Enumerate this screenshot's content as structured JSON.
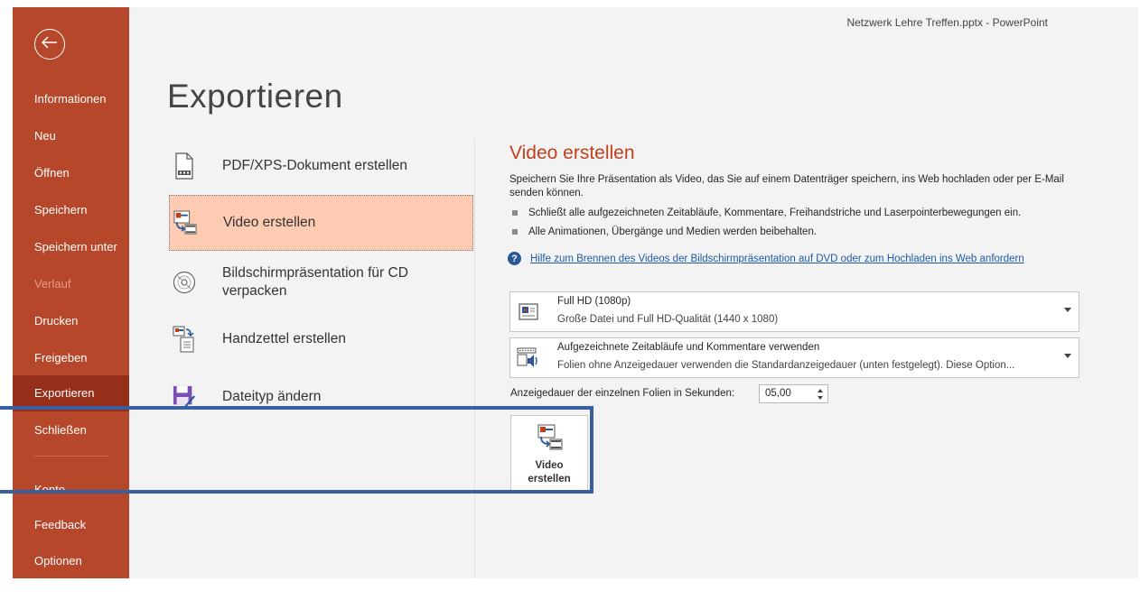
{
  "window": {
    "title": "Netzwerk Lehre Treffen.pptx  -  PowerPoint"
  },
  "sidebar": {
    "back_icon": "back-arrow-icon",
    "items": [
      {
        "label": "Informationen",
        "state": "normal"
      },
      {
        "label": "Neu",
        "state": "normal"
      },
      {
        "label": "Öffnen",
        "state": "normal"
      },
      {
        "label": "Speichern",
        "state": "normal"
      },
      {
        "label": "Speichern unter",
        "state": "normal"
      },
      {
        "label": "Verlauf",
        "state": "disabled"
      },
      {
        "label": "Drucken",
        "state": "normal"
      },
      {
        "label": "Freigeben",
        "state": "normal"
      },
      {
        "label": "Exportieren",
        "state": "selected"
      },
      {
        "label": "Schließen",
        "state": "normal"
      },
      {
        "label": "Konto",
        "state": "normal"
      },
      {
        "label": "Feedback",
        "state": "normal"
      },
      {
        "label": "Optionen",
        "state": "normal"
      }
    ]
  },
  "main": {
    "title": "Exportieren",
    "options": [
      {
        "label": "PDF/XPS-Dokument erstellen",
        "icon": "pdf-document-icon",
        "selected": false
      },
      {
        "label": "Video erstellen",
        "icon": "video-icon",
        "selected": true
      },
      {
        "label_line1": "Bildschirmpräsentation für CD",
        "label_line2": "verpacken",
        "icon": "cd-icon",
        "selected": false
      },
      {
        "label": "Handzettel erstellen",
        "icon": "handout-icon",
        "selected": false
      },
      {
        "label": "Dateityp ändern",
        "icon": "change-file-type-icon",
        "selected": false
      }
    ]
  },
  "video_panel": {
    "title": "Video erstellen",
    "description": "Speichern Sie Ihre Präsentation als Video, das Sie auf einem Datenträger speichern, ins Web hochladen oder per E-Mail senden können.",
    "bullets": [
      "Schließt alle aufgezeichneten Zeitabläufe, Kommentare, Freihandstriche und Laserpointerbewegungen ein.",
      "Alle Animationen, Übergänge und Medien werden beibehalten."
    ],
    "help_link": "Hilfe zum Brennen des Videos der Bildschirmpräsentation auf DVD oder zum Hochladen ins Web anfordern",
    "quality_dropdown": {
      "title": "Full HD (1080p)",
      "subtitle": "Große Datei und Full HD-Qualität (1440 x 1080)"
    },
    "timing_dropdown": {
      "title": "Aufgezeichnete Zeitabläufe und Kommentare verwenden",
      "subtitle": "Folien ohne Anzeigedauer verwenden die Standardanzeigedauer (unten festgelegt). Diese Option..."
    },
    "duration_label": "Anzeigedauer der einzelnen Folien in Sekunden:",
    "duration_value": "05,00",
    "create_button_line1": "Video",
    "create_button_line2": "erstellen"
  },
  "colors": {
    "sidebar_bg": "#b7472a",
    "sidebar_selected": "#952f1a",
    "accent_title": "#c43e1c",
    "selected_option_bg": "#fccbb1",
    "annotation_line": "#3a5fa0"
  }
}
